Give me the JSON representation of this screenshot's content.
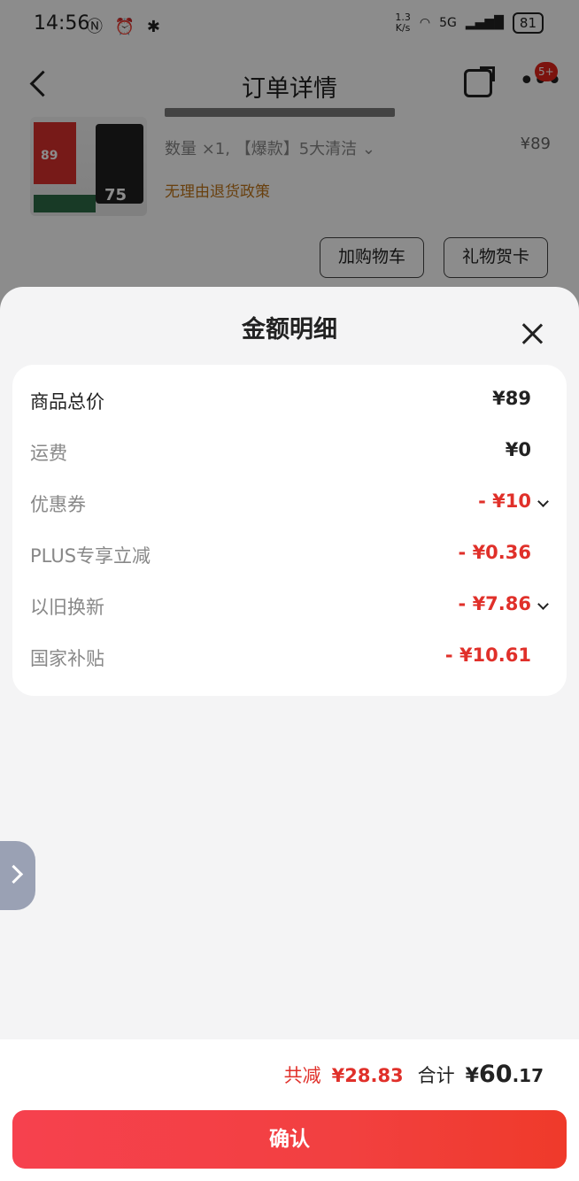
{
  "status_bar": {
    "time": "14:56",
    "net_speed_value": "1.3",
    "net_speed_unit": "K/s",
    "network": "5G",
    "battery": "81"
  },
  "nav": {
    "title": "订单详情",
    "badge": "5+"
  },
  "product": {
    "spec": "数量 ×1, 【爆款】5大清洁 ⌄",
    "price": "¥89",
    "policy": "无理由退货政策",
    "thumb_badge": "89",
    "thumb_number": "75"
  },
  "actions": {
    "add_cart": "加购物车",
    "gift_card": "礼物贺卡"
  },
  "sheet": {
    "title": "金额明细",
    "rows": [
      {
        "label": "商品总价",
        "value": "¥89"
      },
      {
        "label": "运费",
        "value": "¥0"
      },
      {
        "label": "优惠券",
        "value": "- ¥10"
      },
      {
        "label": "PLUS专享立减",
        "value": "- ¥0.36"
      },
      {
        "label": "以旧换新",
        "value": "- ¥7.86"
      },
      {
        "label": "国家补贴",
        "value": "- ¥10.61"
      }
    ]
  },
  "footer": {
    "reduce_label": "共减",
    "reduce_value": "¥28.83",
    "total_label": "合计",
    "total_yen": "¥",
    "total_int": "60",
    "total_dec": ".17",
    "confirm": "确认"
  },
  "colors": {
    "accent_red": "#e0302a",
    "button_red": "#f24040",
    "policy_orange": "#c0761a"
  }
}
